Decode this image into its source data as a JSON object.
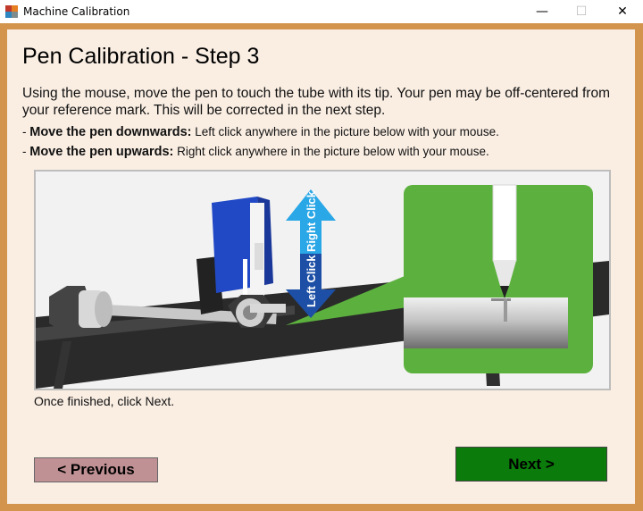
{
  "window": {
    "title": "Machine Calibration",
    "controls": {
      "minimize": "—",
      "maximize": "☐",
      "close": "✕"
    }
  },
  "heading": "Pen Calibration - Step 3",
  "instructions": "Using the mouse, move the pen to touch the tube with its tip. Your pen may be off-centered from your reference mark. This will be corrected in the next step.",
  "bullets": [
    {
      "prefix": "- ",
      "bold": "Move the pen downwards:",
      "text": " Left click anywhere in the picture below with your mouse."
    },
    {
      "prefix": "- ",
      "bold": "Move the pen upwards:",
      "text": " Right click anywhere in the picture below with your mouse."
    }
  ],
  "picture": {
    "arrow_up_label": "Right Click",
    "arrow_down_label": "Left Click"
  },
  "footer_text": "Once finished, click Next.",
  "buttons": {
    "previous": "< Previous",
    "next": "Next >"
  }
}
